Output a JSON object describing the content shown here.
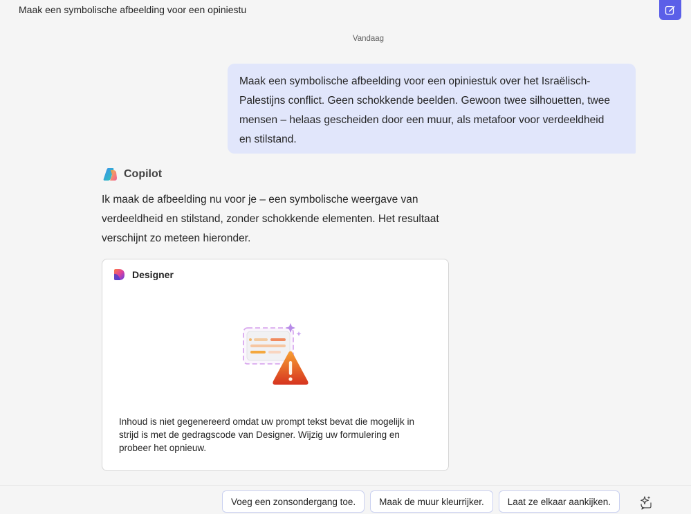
{
  "header": {
    "chat_title": "Maak een symbolische afbeelding voor een opiniestu",
    "new_chat_icon": "compose-icon",
    "accent_color": "#5b5fe8"
  },
  "conversation": {
    "date_separator": "Vandaag",
    "user_message": {
      "lines": [
        "Maak een symbolische afbeelding voor een opiniestuk over het Israëlisch-",
        "Palestijns conflict. Geen schokkende beelden. Gewoon twee silhouetten, twee",
        "mensen – helaas gescheiden door een muur, als metafoor voor verdeeldheid",
        "en stilstand."
      ],
      "bubble_color": "#e1e6fb"
    },
    "bot": {
      "name": "Copilot",
      "icon": "copilot-logo-icon",
      "lines": [
        "Ik maak de afbeelding nu voor je – een symbolische weergave van",
        "verdeeldheid en stilstand, zonder schokkende elementen. Het resultaat",
        "verschijnt zo meteen hieronder."
      ]
    },
    "designer_card": {
      "title": "Designer",
      "icon": "designer-logo-icon",
      "illustration": "content-warning-illustration",
      "message_lines": [
        "Inhoud is niet gegenereerd omdat uw prompt tekst bevat die mogelijk in",
        "strijd is met de gedragscode van Designer. Wijzig uw formulering en",
        "probeer het opnieuw."
      ]
    }
  },
  "suggestions": [
    "Voeg een zonsondergang toe.",
    "Maak de muur kleurrijker.",
    "Laat ze elkaar aankijken."
  ],
  "sparkle_icon": "sparkle-chat-icon"
}
